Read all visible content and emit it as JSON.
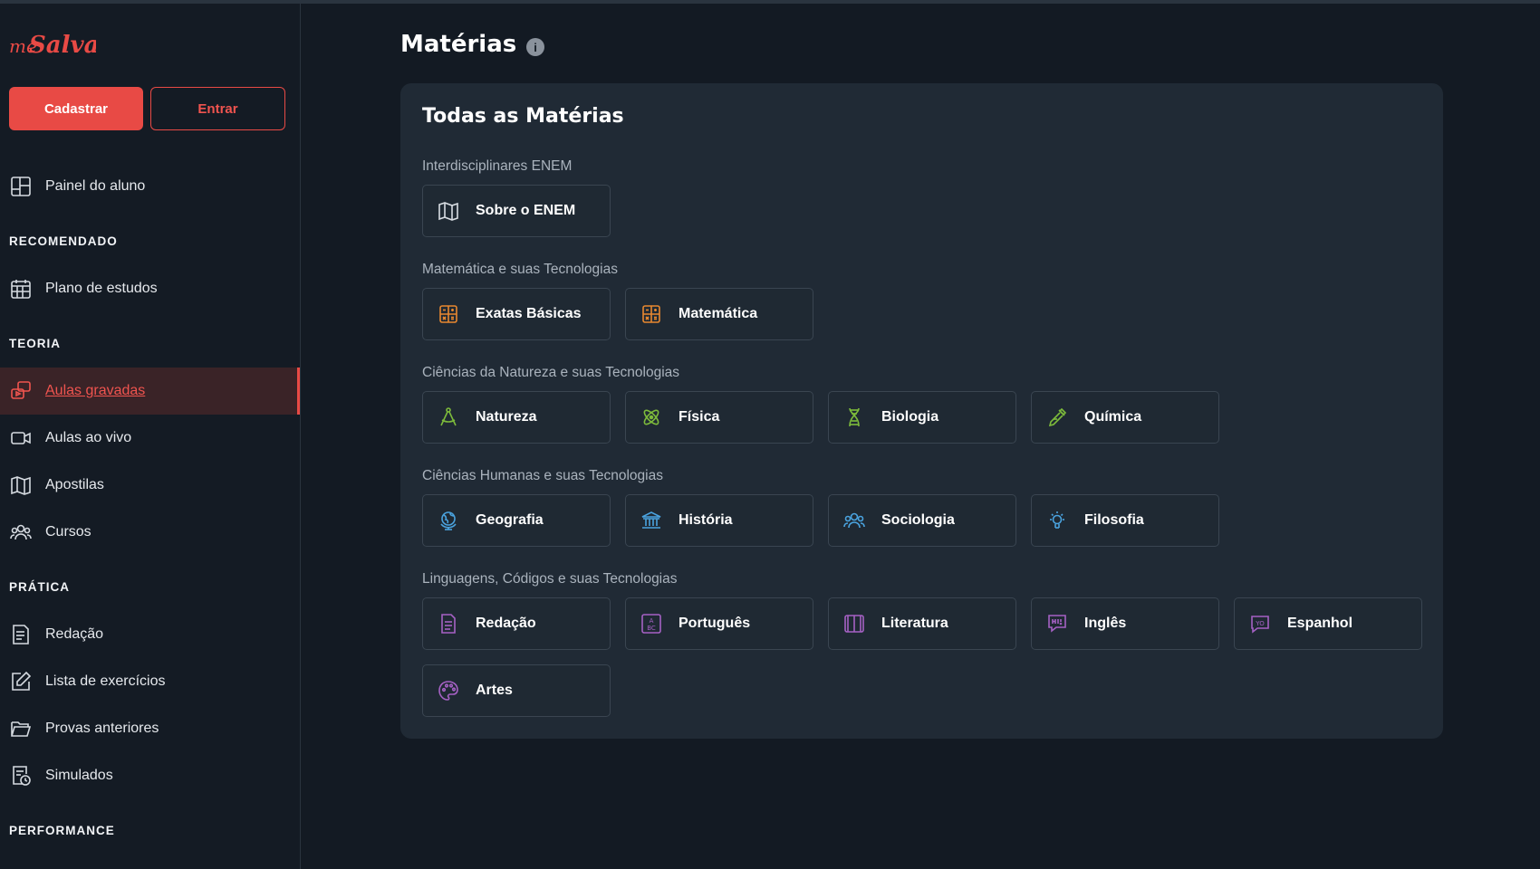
{
  "app": {
    "logo_text": "meSalva!",
    "brand_color": "#e84a45"
  },
  "sidebar": {
    "signup_label": "Cadastrar",
    "login_label": "Entrar",
    "dashboard": {
      "label": "Painel do aluno",
      "icon": "dashboard-icon"
    },
    "sections": [
      {
        "title": "RECOMENDADO",
        "items": [
          {
            "label": "Plano de estudos",
            "icon": "calendar-icon"
          }
        ]
      },
      {
        "title": "TEORIA",
        "items": [
          {
            "label": "Aulas gravadas",
            "icon": "recorded-lessons-icon",
            "active": true
          },
          {
            "label": "Aulas ao vivo",
            "icon": "video-camera-icon"
          },
          {
            "label": "Apostilas",
            "icon": "book-open-icon"
          },
          {
            "label": "Cursos",
            "icon": "users-icon"
          }
        ]
      },
      {
        "title": "PRÁTICA",
        "items": [
          {
            "label": "Redação",
            "icon": "essay-icon"
          },
          {
            "label": "Lista de exercícios",
            "icon": "edit-icon"
          },
          {
            "label": "Provas anteriores",
            "icon": "folder-icon"
          },
          {
            "label": "Simulados",
            "icon": "timed-exam-icon"
          }
        ]
      },
      {
        "title": "PERFORMANCE",
        "items": []
      }
    ]
  },
  "main": {
    "title": "Matérias",
    "info_icon": "info-icon",
    "card_title": "Todas as Matérias",
    "categories": [
      {
        "title": "Interdisciplinares ENEM",
        "color": "#d8dde3",
        "subjects": [
          {
            "label": "Sobre o ENEM",
            "icon": "map-icon"
          }
        ]
      },
      {
        "title": "Matemática e suas Tecnologias",
        "color": "#e8882f",
        "subjects": [
          {
            "label": "Exatas Básicas",
            "icon": "calculator-icon"
          },
          {
            "label": "Matemática",
            "icon": "calculator-icon"
          }
        ]
      },
      {
        "title": "Ciências da Natureza e suas Tecnologias",
        "color": "#7dbb3b",
        "subjects": [
          {
            "label": "Natureza",
            "icon": "compass-icon"
          },
          {
            "label": "Física",
            "icon": "atom-icon"
          },
          {
            "label": "Biologia",
            "icon": "dna-icon"
          },
          {
            "label": "Química",
            "icon": "pipette-icon"
          }
        ]
      },
      {
        "title": "Ciências Humanas e suas Tecnologias",
        "color": "#4aa3df",
        "subjects": [
          {
            "label": "Geografia",
            "icon": "globe-icon"
          },
          {
            "label": "História",
            "icon": "museum-icon"
          },
          {
            "label": "Sociologia",
            "icon": "people-icon"
          },
          {
            "label": "Filosofia",
            "icon": "lightbulb-icon"
          }
        ]
      },
      {
        "title": "Linguagens, Códigos e suas Tecnologias",
        "color": "#a561c4",
        "subjects": [
          {
            "label": "Redação",
            "icon": "document-icon"
          },
          {
            "label": "Português",
            "icon": "abc-icon"
          },
          {
            "label": "Literatura",
            "icon": "book-icon"
          },
          {
            "label": "Inglês",
            "icon": "speech-hi-icon"
          },
          {
            "label": "Espanhol",
            "icon": "speech-yo-icon"
          },
          {
            "label": "Artes",
            "icon": "palette-icon"
          }
        ]
      }
    ]
  }
}
